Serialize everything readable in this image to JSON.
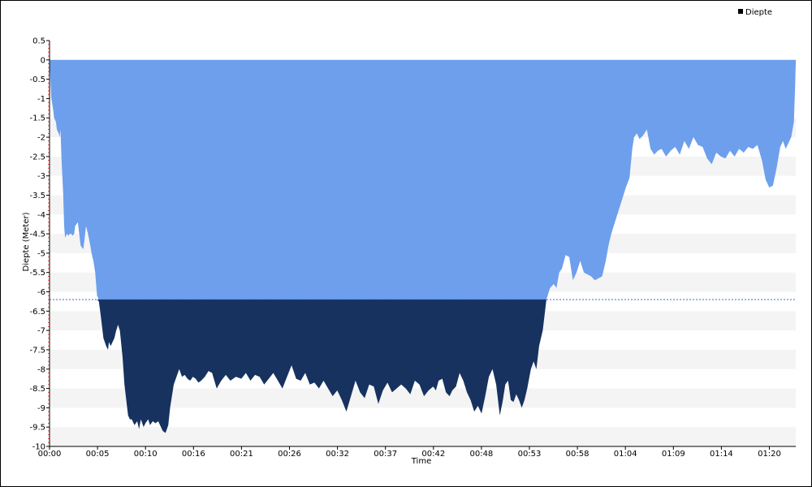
{
  "chart_data": {
    "type": "area",
    "xlabel": "Time",
    "ylabel": "Diepte (Meter)",
    "ylim": [
      -10,
      0.5
    ],
    "y_ticks": [
      "0.5",
      "0",
      "-0.5",
      "-1",
      "-1.5",
      "-2",
      "-2.5",
      "-3",
      "-3.5",
      "-4",
      "-4.5",
      "-5",
      "-5.5",
      "-6",
      "-6.5",
      "-7",
      "-7.5",
      "-8",
      "-8.5",
      "-9",
      "-9.5",
      "-10"
    ],
    "x_range_minutes": [
      0,
      81.7
    ],
    "x_ticks": [
      "00:00",
      "00:05",
      "00:10",
      "00:16",
      "00:21",
      "00:26",
      "00:32",
      "00:37",
      "00:42",
      "00:48",
      "00:53",
      "00:58",
      "01:04",
      "01:09",
      "01:14",
      "01:20"
    ],
    "legend": "top-right",
    "threshold": -6.2,
    "colors": {
      "upper_fill": "#6e9fec",
      "lower_fill": "#17325f",
      "threshold_line": "#2c4fd6",
      "band": "#f4f4f4"
    },
    "series": [
      {
        "name": "Diepte",
        "x_minutes": [
          0,
          0.1,
          0.2,
          0.4,
          0.5,
          0.7,
          0.8,
          1.0,
          1.1,
          1.2,
          1.3,
          1.5,
          1.6,
          1.7,
          1.9,
          2.1,
          2.2,
          2.4,
          2.5,
          2.7,
          2.8,
          3.1,
          3.4,
          3.7,
          4.0,
          4.3,
          4.5,
          4.6,
          4.8,
          5.0,
          5.2,
          5.4,
          5.6,
          5.9,
          6.2,
          6.4,
          6.5,
          6.7,
          6.9,
          7.1,
          7.3,
          7.5,
          7.7,
          8.0,
          8.2,
          8.4,
          8.6,
          8.8,
          9.0,
          9.3,
          9.6,
          9.8,
          10.0,
          10.3,
          10.5,
          10.8,
          11.0,
          11.3,
          11.6,
          11.9,
          12.1,
          12.4,
          12.7,
          13.0,
          13.2,
          13.6,
          13.9,
          14.2,
          14.5,
          14.8,
          15.1,
          15.4,
          15.7,
          16.0,
          16.3,
          16.6,
          17.0,
          17.4,
          17.8,
          18.3,
          18.8,
          19.3,
          19.8,
          20.4,
          21.0,
          21.5,
          22.0,
          22.5,
          23.0,
          23.5,
          24.0,
          24.5,
          25.0,
          25.5,
          26.0,
          26.5,
          27.0,
          27.5,
          28.0,
          28.5,
          29.0,
          29.5,
          30.0,
          30.5,
          31.0,
          31.5,
          32.0,
          32.5,
          33.0,
          33.5,
          34.0,
          34.5,
          35.0,
          35.5,
          36.0,
          36.5,
          37.0,
          37.5,
          38.0,
          38.5,
          39.0,
          39.5,
          40.0,
          40.5,
          41.0,
          41.5,
          42.0,
          42.3,
          42.6,
          43.0,
          43.4,
          43.8,
          44.1,
          44.5,
          44.9,
          45.3,
          45.7,
          46.1,
          46.5,
          46.9,
          47.3,
          47.7,
          48.1,
          48.5,
          48.9,
          49.3,
          49.6,
          49.9,
          50.2,
          50.5,
          50.8,
          51.1,
          51.4,
          51.7,
          52.0,
          52.3,
          52.7,
          53.0,
          53.3,
          53.6,
          54.0,
          54.4,
          54.8,
          55.2,
          55.5,
          55.8,
          56.1,
          56.5,
          56.9,
          57.3,
          57.7,
          58.1,
          58.5,
          58.9,
          59.3,
          59.7,
          60.1,
          60.5,
          60.9,
          61.2,
          61.5,
          61.9,
          62.3,
          62.7,
          63.1,
          63.5,
          63.8,
          64.0,
          64.3,
          64.6,
          65.0,
          65.4,
          65.8,
          66.2,
          66.6,
          67.0,
          67.5,
          68.0,
          68.5,
          69.0,
          69.5,
          70.0,
          70.5,
          71.0,
          71.5,
          72.0,
          72.5,
          73.0,
          73.5,
          74.0,
          74.5,
          75.0,
          75.5,
          76.0,
          76.5,
          77.0,
          77.5,
          78.0,
          78.4,
          78.8,
          79.2,
          79.6,
          80.0,
          80.3,
          80.6,
          80.9,
          81.2,
          81.5,
          81.7
        ],
        "y_values": [
          -0.1,
          -0.5,
          -1.0,
          -1.3,
          -1.5,
          -1.6,
          -1.8,
          -1.9,
          -2.0,
          -1.8,
          -2.5,
          -3.5,
          -4.3,
          -4.6,
          -4.5,
          -4.55,
          -4.5,
          -4.5,
          -4.55,
          -4.5,
          -4.3,
          -4.2,
          -4.8,
          -4.9,
          -4.3,
          -4.6,
          -4.85,
          -5.0,
          -5.2,
          -5.5,
          -6.1,
          -6.25,
          -6.6,
          -7.2,
          -7.4,
          -7.5,
          -7.3,
          -7.4,
          -7.3,
          -7.2,
          -7.0,
          -6.85,
          -7.0,
          -7.7,
          -8.4,
          -8.8,
          -9.2,
          -9.3,
          -9.3,
          -9.45,
          -9.35,
          -9.55,
          -9.3,
          -9.5,
          -9.4,
          -9.3,
          -9.45,
          -9.35,
          -9.4,
          -9.35,
          -9.45,
          -9.6,
          -9.65,
          -9.45,
          -9.0,
          -8.4,
          -8.2,
          -8.0,
          -8.2,
          -8.15,
          -8.25,
          -8.3,
          -8.2,
          -8.25,
          -8.35,
          -8.3,
          -8.2,
          -8.05,
          -8.1,
          -8.5,
          -8.3,
          -8.15,
          -8.3,
          -8.2,
          -8.25,
          -8.1,
          -8.3,
          -8.15,
          -8.2,
          -8.4,
          -8.25,
          -8.1,
          -8.3,
          -8.5,
          -8.2,
          -7.9,
          -8.25,
          -8.3,
          -8.1,
          -8.4,
          -8.35,
          -8.5,
          -8.3,
          -8.5,
          -8.7,
          -8.55,
          -8.8,
          -9.1,
          -8.7,
          -8.3,
          -8.6,
          -8.75,
          -8.4,
          -8.45,
          -8.9,
          -8.55,
          -8.35,
          -8.6,
          -8.5,
          -8.4,
          -8.5,
          -8.65,
          -8.3,
          -8.4,
          -8.7,
          -8.55,
          -8.45,
          -8.55,
          -8.3,
          -8.25,
          -8.6,
          -8.7,
          -8.55,
          -8.45,
          -8.1,
          -8.3,
          -8.6,
          -8.8,
          -9.1,
          -8.95,
          -9.15,
          -8.7,
          -8.2,
          -8.0,
          -8.4,
          -9.2,
          -8.85,
          -8.4,
          -8.3,
          -8.8,
          -8.85,
          -8.65,
          -8.8,
          -9.0,
          -8.8,
          -8.5,
          -8.0,
          -7.8,
          -8.0,
          -7.4,
          -7.0,
          -6.2,
          -5.9,
          -5.8,
          -5.9,
          -5.5,
          -5.4,
          -5.05,
          -5.1,
          -5.7,
          -5.5,
          -5.2,
          -5.5,
          -5.55,
          -5.6,
          -5.7,
          -5.65,
          -5.6,
          -5.2,
          -4.8,
          -4.5,
          -4.2,
          -3.9,
          -3.6,
          -3.3,
          -3.05,
          -2.3,
          -2.0,
          -1.9,
          -2.05,
          -1.95,
          -1.8,
          -2.3,
          -2.45,
          -2.35,
          -2.3,
          -2.5,
          -2.35,
          -2.25,
          -2.45,
          -2.1,
          -2.3,
          -2.0,
          -2.2,
          -2.25,
          -2.55,
          -2.7,
          -2.4,
          -2.5,
          -2.55,
          -2.35,
          -2.5,
          -2.3,
          -2.4,
          -2.25,
          -2.3,
          -2.2,
          -2.6,
          -3.1,
          -3.3,
          -3.25,
          -2.8,
          -2.25,
          -2.1,
          -2.3,
          -2.15,
          -2.0,
          -1.6,
          -0.1
        ]
      }
    ]
  }
}
